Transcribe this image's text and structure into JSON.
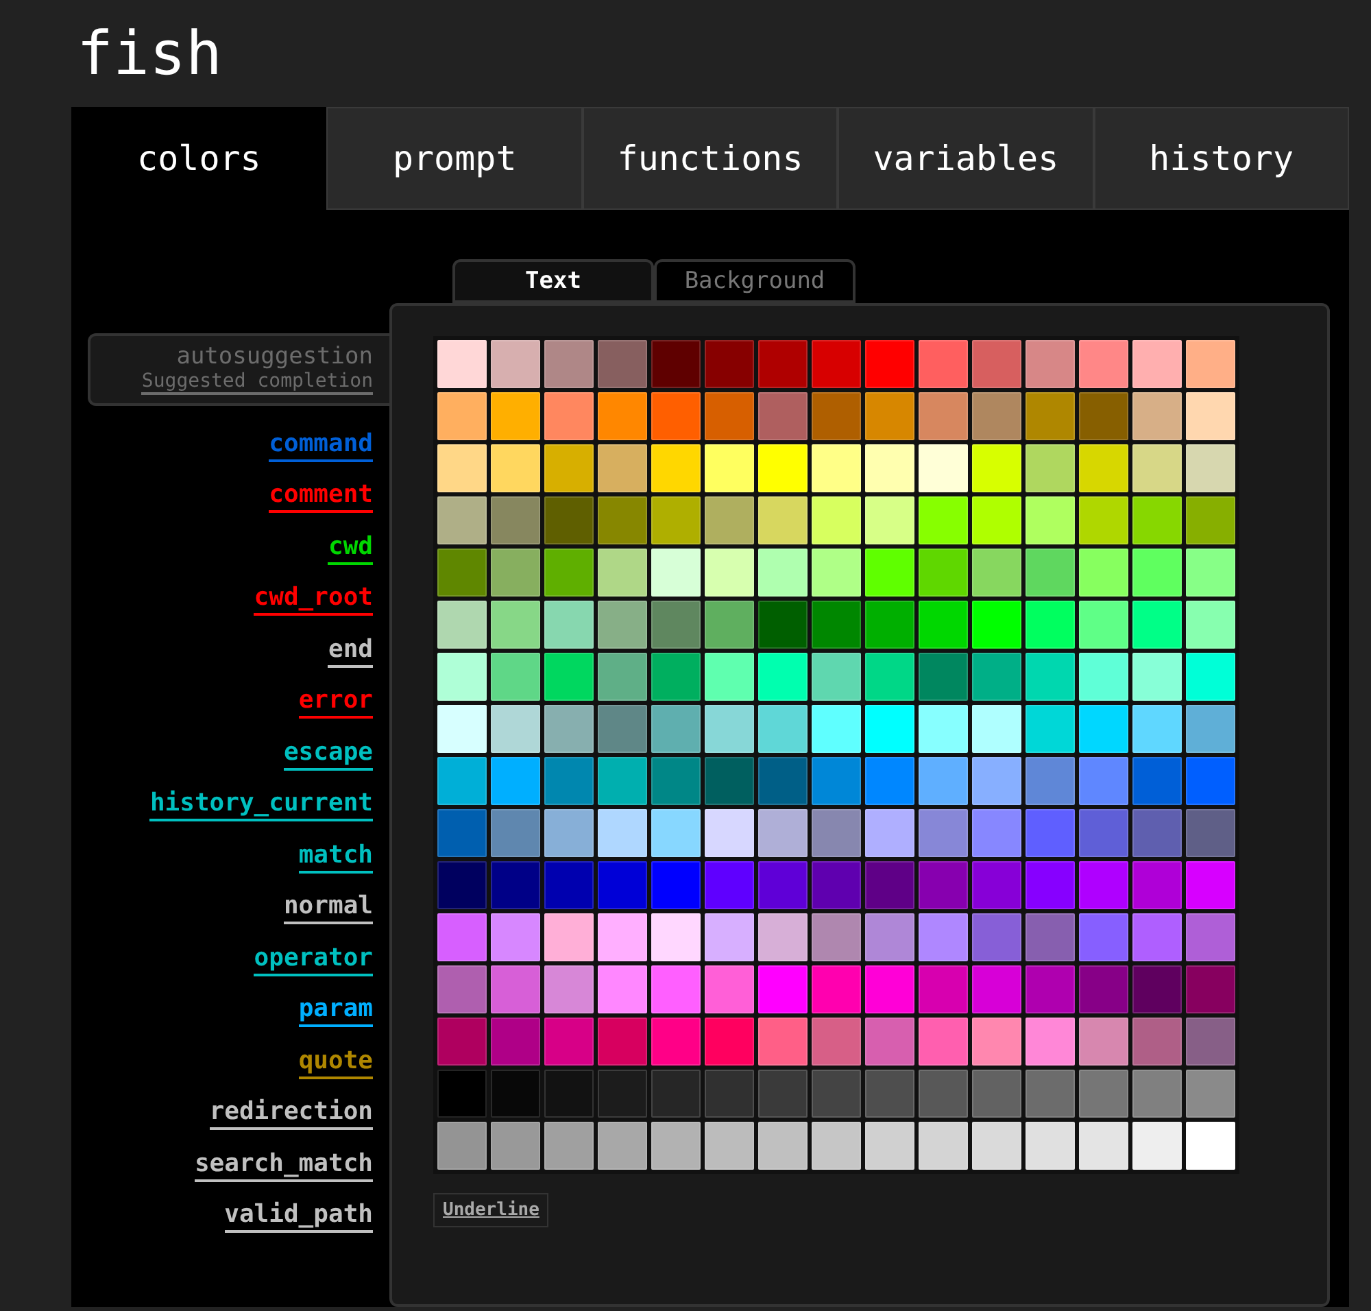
{
  "title": "fish",
  "tabs": [
    {
      "label": "colors",
      "selected": true
    },
    {
      "label": "prompt",
      "selected": false
    },
    {
      "label": "functions",
      "selected": false
    },
    {
      "label": "variables",
      "selected": false
    },
    {
      "label": "history",
      "selected": false
    }
  ],
  "mode_tabs": [
    {
      "label": "Text",
      "selected": true
    },
    {
      "label": "Background",
      "selected": false
    }
  ],
  "settings": [
    {
      "label": "autosuggestion",
      "description": "Suggested completion",
      "color": "#6c6c6c",
      "selected": true
    },
    {
      "label": "command",
      "color": "#005fd7",
      "selected": false
    },
    {
      "label": "comment",
      "color": "#ff0000",
      "selected": false
    },
    {
      "label": "cwd",
      "color": "#00d700",
      "selected": false
    },
    {
      "label": "cwd_root",
      "color": "#ff0000",
      "selected": false
    },
    {
      "label": "end",
      "color": "#c0c0c0",
      "selected": false
    },
    {
      "label": "error",
      "color": "#ff0000",
      "selected": false
    },
    {
      "label": "escape",
      "color": "#00c0c0",
      "selected": false
    },
    {
      "label": "history_current",
      "color": "#00c0c0",
      "selected": false
    },
    {
      "label": "match",
      "color": "#00c0c0",
      "selected": false
    },
    {
      "label": "normal",
      "color": "#c0c0c0",
      "selected": false
    },
    {
      "label": "operator",
      "color": "#00c0c0",
      "selected": false
    },
    {
      "label": "param",
      "color": "#00afff",
      "selected": false
    },
    {
      "label": "quote",
      "color": "#af8700",
      "selected": false
    },
    {
      "label": "redirection",
      "color": "#c0c0c0",
      "selected": false
    },
    {
      "label": "search_match",
      "color": "#c0c0c0",
      "selected": false
    },
    {
      "label": "valid_path",
      "color": "#c0c0c0",
      "selected": false
    }
  ],
  "swatch_rows": [
    [
      {
        "color": "#ffd7d7"
      },
      {
        "color": "#d7afaf"
      },
      {
        "color": "#af8787"
      },
      {
        "color": "#875f5f"
      },
      {
        "color": "#5f0000"
      },
      {
        "color": "#870000"
      },
      {
        "color": "#af0000"
      },
      {
        "color": "#d70000"
      },
      {
        "color": "#ff0000"
      },
      {
        "color": "#ff5f5f"
      },
      {
        "color": "#d75f5f"
      },
      {
        "color": "#d78787"
      },
      {
        "color": "#ff8787"
      },
      {
        "color": "#ffafaf"
      },
      {
        "color": "#ffaf87"
      }
    ],
    [
      {
        "color": "#ffaf5f"
      },
      {
        "color": "#ffaf00"
      },
      {
        "color": "#ff875f"
      },
      {
        "color": "#ff8700"
      },
      {
        "color": "#ff5f00"
      },
      {
        "color": "#d75f00"
      },
      {
        "color": "#af5f5f"
      },
      {
        "color": "#af5f00"
      },
      {
        "color": "#d78700"
      },
      {
        "color": "#d7875f"
      },
      {
        "color": "#af875f"
      },
      {
        "color": "#af8700"
      },
      {
        "color": "#875f00"
      },
      {
        "color": "#d7af87"
      },
      {
        "color": "#ffd7af"
      }
    ],
    [
      {
        "color": "#ffd787"
      },
      {
        "color": "#ffd75f"
      },
      {
        "color": "#d7af00"
      },
      {
        "color": "#d7af5f"
      },
      {
        "color": "#ffd700"
      },
      {
        "color": "#ffff5f"
      },
      {
        "color": "#ffff00"
      },
      {
        "color": "#ffff87"
      },
      {
        "color": "#ffffaf"
      },
      {
        "color": "#ffffd7"
      },
      {
        "color": "#d7ff00"
      },
      {
        "color": "#afd75f"
      },
      {
        "color": "#d7d700"
      },
      {
        "color": "#d7d787"
      },
      {
        "color": "#d7d7af"
      }
    ],
    [
      {
        "color": "#afaf87"
      },
      {
        "color": "#87875f"
      },
      {
        "color": "#5f5f00"
      },
      {
        "color": "#878700"
      },
      {
        "color": "#afaf00"
      },
      {
        "color": "#afaf5f"
      },
      {
        "color": "#d7d75f"
      },
      {
        "color": "#d7ff5f"
      },
      {
        "color": "#d7ff87"
      },
      {
        "color": "#87ff00"
      },
      {
        "color": "#afff00"
      },
      {
        "color": "#afff5f"
      },
      {
        "color": "#afd700"
      },
      {
        "color": "#87d700"
      },
      {
        "color": "#87af00"
      }
    ],
    [
      {
        "color": "#5f8700"
      },
      {
        "color": "#87af5f"
      },
      {
        "color": "#5faf00"
      },
      {
        "color": "#afd787"
      },
      {
        "color": "#d7ffd7"
      },
      {
        "color": "#d7ffaf"
      },
      {
        "color": "#afffaf"
      },
      {
        "color": "#afff87"
      },
      {
        "color": "#5fff00"
      },
      {
        "color": "#5fd700"
      },
      {
        "color": "#87d75f"
      },
      {
        "color": "#5fd75f"
      },
      {
        "color": "#87ff5f"
      },
      {
        "color": "#5fff5f"
      },
      {
        "color": "#87ff87"
      }
    ],
    [
      {
        "color": "#afd7af"
      },
      {
        "color": "#87d787"
      },
      {
        "color": "#87d7af"
      },
      {
        "color": "#87af87"
      },
      {
        "color": "#5f875f"
      },
      {
        "color": "#5faf5f"
      },
      {
        "color": "#005f00"
      },
      {
        "color": "#008700"
      },
      {
        "color": "#00af00"
      },
      {
        "color": "#00d700"
      },
      {
        "color": "#00ff00"
      },
      {
        "color": "#00ff5f"
      },
      {
        "color": "#5fff87"
      },
      {
        "color": "#00ff87"
      },
      {
        "color": "#87ffaf"
      }
    ],
    [
      {
        "color": "#afffd7"
      },
      {
        "color": "#5fd787"
      },
      {
        "color": "#00d75f"
      },
      {
        "color": "#5faf87"
      },
      {
        "color": "#00af5f"
      },
      {
        "color": "#5fffaf"
      },
      {
        "color": "#00ffaf"
      },
      {
        "color": "#5fd7af"
      },
      {
        "color": "#00d787"
      },
      {
        "color": "#00875f"
      },
      {
        "color": "#00af87"
      },
      {
        "color": "#00d7af"
      },
      {
        "color": "#5fffd7"
      },
      {
        "color": "#87ffd7"
      },
      {
        "color": "#00ffd7"
      }
    ],
    [
      {
        "color": "#d7ffff"
      },
      {
        "color": "#afd7d7"
      },
      {
        "color": "#87afaf"
      },
      {
        "color": "#5f8787"
      },
      {
        "color": "#5fafaf"
      },
      {
        "color": "#87d7d7"
      },
      {
        "color": "#5fd7d7"
      },
      {
        "color": "#5fffff"
      },
      {
        "color": "#00ffff"
      },
      {
        "color": "#87ffff"
      },
      {
        "color": "#afffff"
      },
      {
        "color": "#00d7d7"
      },
      {
        "color": "#00d7ff"
      },
      {
        "color": "#5fd7ff"
      },
      {
        "color": "#5fafd7"
      }
    ],
    [
      {
        "color": "#00afd7"
      },
      {
        "color": "#00afff"
      },
      {
        "color": "#0087af"
      },
      {
        "color": "#00afaf"
      },
      {
        "color": "#008787"
      },
      {
        "color": "#005f5f"
      },
      {
        "color": "#005f87"
      },
      {
        "color": "#0087d7"
      },
      {
        "color": "#0087ff"
      },
      {
        "color": "#5fafff"
      },
      {
        "color": "#87afff"
      },
      {
        "color": "#5f87d7"
      },
      {
        "color": "#5f87ff"
      },
      {
        "color": "#005fd7"
      },
      {
        "color": "#005fff"
      }
    ],
    [
      {
        "color": "#005faf"
      },
      {
        "color": "#5f87af"
      },
      {
        "color": "#87afd7"
      },
      {
        "color": "#afd7ff"
      },
      {
        "color": "#87d7ff"
      },
      {
        "color": "#d7d7ff"
      },
      {
        "color": "#afafd7"
      },
      {
        "color": "#8787af"
      },
      {
        "color": "#afafff"
      },
      {
        "color": "#8787d7"
      },
      {
        "color": "#8787ff"
      },
      {
        "color": "#5f5fff"
      },
      {
        "color": "#5f5fd7"
      },
      {
        "color": "#5f5faf"
      },
      {
        "color": "#5f5f87"
      }
    ],
    [
      {
        "color": "#00005f"
      },
      {
        "color": "#000087"
      },
      {
        "color": "#0000af"
      },
      {
        "color": "#0000d7"
      },
      {
        "color": "#0000ff"
      },
      {
        "color": "#5f00ff"
      },
      {
        "color": "#5f00d7"
      },
      {
        "color": "#5f00af"
      },
      {
        "color": "#5f0087"
      },
      {
        "color": "#8700af"
      },
      {
        "color": "#8700d7"
      },
      {
        "color": "#8700ff"
      },
      {
        "color": "#af00ff"
      },
      {
        "color": "#af00d7"
      },
      {
        "color": "#d700ff"
      }
    ],
    [
      {
        "color": "#d75fff"
      },
      {
        "color": "#d787ff"
      },
      {
        "color": "#ffafd7"
      },
      {
        "color": "#ffafff"
      },
      {
        "color": "#ffd7ff"
      },
      {
        "color": "#d7afff"
      },
      {
        "color": "#d7afd7"
      },
      {
        "color": "#af87af"
      },
      {
        "color": "#af87d7"
      },
      {
        "color": "#af87ff"
      },
      {
        "color": "#875fd7"
      },
      {
        "color": "#875faf"
      },
      {
        "color": "#875fff"
      },
      {
        "color": "#af5fff"
      },
      {
        "color": "#af5fd7"
      }
    ],
    [
      {
        "color": "#af5faf"
      },
      {
        "color": "#d75fd7"
      },
      {
        "color": "#d787d7"
      },
      {
        "color": "#ff87ff"
      },
      {
        "color": "#ff5fff"
      },
      {
        "color": "#ff5fd7"
      },
      {
        "color": "#ff00ff"
      },
      {
        "color": "#ff00af"
      },
      {
        "color": "#ff00d7"
      },
      {
        "color": "#d700af"
      },
      {
        "color": "#d700d7"
      },
      {
        "color": "#af00af"
      },
      {
        "color": "#870087"
      },
      {
        "color": "#5f005f"
      },
      {
        "color": "#87005f"
      }
    ],
    [
      {
        "color": "#af005f"
      },
      {
        "color": "#af0087"
      },
      {
        "color": "#d70087"
      },
      {
        "color": "#d7005f"
      },
      {
        "color": "#ff0087"
      },
      {
        "color": "#ff005f"
      },
      {
        "color": "#ff5f87"
      },
      {
        "color": "#d75f87"
      },
      {
        "color": "#d75faf"
      },
      {
        "color": "#ff5faf"
      },
      {
        "color": "#ff87af"
      },
      {
        "color": "#ff87d7"
      },
      {
        "color": "#d787af"
      },
      {
        "color": "#af5f87"
      },
      {
        "color": "#875f87"
      }
    ],
    [
      {
        "color": "#000000"
      },
      {
        "color": "#080808"
      },
      {
        "color": "#121212"
      },
      {
        "color": "#1c1c1c"
      },
      {
        "color": "#262626"
      },
      {
        "color": "#303030"
      },
      {
        "color": "#3a3a3a"
      },
      {
        "color": "#444444"
      },
      {
        "color": "#4e4e4e"
      },
      {
        "color": "#585858"
      },
      {
        "color": "#626262"
      },
      {
        "color": "#6c6c6c"
      },
      {
        "color": "#767676"
      },
      {
        "color": "#808080"
      },
      {
        "color": "#8a8a8a"
      }
    ],
    [
      {
        "color": "#949494"
      },
      {
        "color": "#999999"
      },
      {
        "color": "#a0a0a0"
      },
      {
        "color": "#a8a8a8"
      },
      {
        "color": "#b2b2b2"
      },
      {
        "color": "#bcbcbc"
      },
      {
        "color": "#c0c0c0"
      },
      {
        "color": "#c6c6c6"
      },
      {
        "color": "#d0d0d0"
      },
      {
        "color": "#d4d4d4"
      },
      {
        "color": "#dadada"
      },
      {
        "color": "#e0e0e0"
      },
      {
        "color": "#e4e4e4"
      },
      {
        "color": "#eeeeee"
      },
      {
        "color": "#ffffff"
      }
    ]
  ],
  "underline_button": "Underline"
}
